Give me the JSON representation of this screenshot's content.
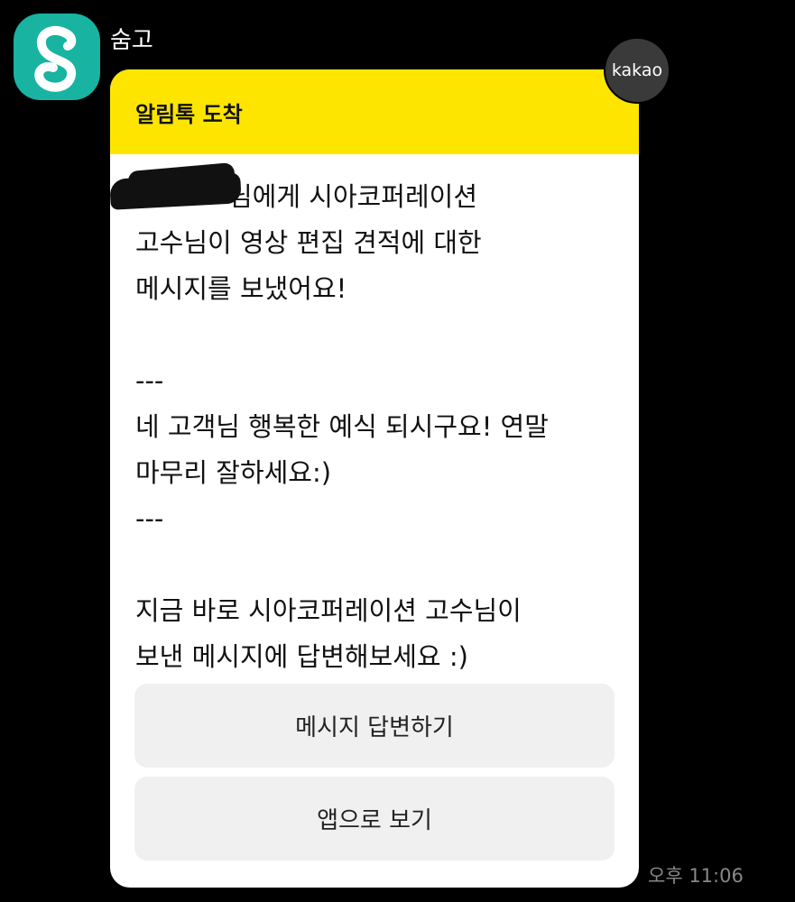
{
  "sender": {
    "name": "숨고",
    "avatar_icon": "soomgo-logo-icon",
    "avatar_color": "#19b3a2"
  },
  "badge": {
    "label": "kakao"
  },
  "card": {
    "header_title": "알림톡 도착",
    "header_color": "#fee500",
    "lines": [
      "님에게 시아코퍼레이션",
      "고수님이 영상 편집 견적에 대한",
      "메시지를 보냈어요!",
      "",
      "---",
      "네 고객님 행복한 예식 되시구요! 연말",
      "마무리 잘하세요:)",
      "---",
      "",
      "지금 바로 시아코퍼레이션 고수님이",
      "보낸 메시지에 답변해보세요 :)"
    ],
    "buttons": {
      "reply_label": "메시지 답변하기",
      "app_label": "앱으로 보기"
    }
  },
  "timestamp": "오후 11:06"
}
